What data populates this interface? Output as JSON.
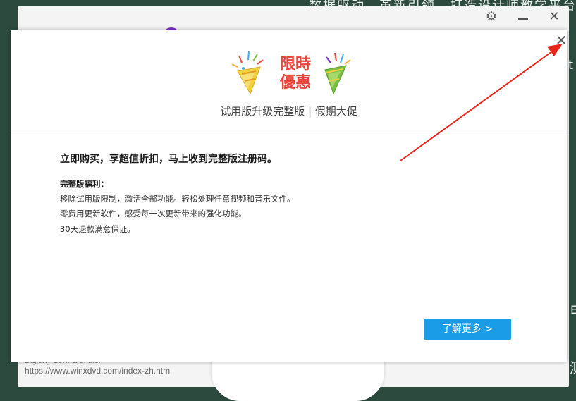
{
  "background": {
    "top_text": "数据驱动，革新引领，打造设计师教学平台",
    "side_char_1": "t",
    "side_char_2": "测",
    "side_char_3": "E"
  },
  "app_window": {
    "footer_company": "Digiarty Software, Inc.",
    "footer_url": "https://www.winxdvd.com/index-zh.htm"
  },
  "dialog": {
    "promo_title_line1": "限時",
    "promo_title_line2": "優惠",
    "subtitle": "试用版升级完整版 | 假期大促",
    "headline": "立即购买，享超值折扣，马上收到完整版注册码。",
    "benefits_title": "完整版福利：",
    "benefits": [
      "移除试用版限制，激活全部功能。轻松处理任意视频和音乐文件。",
      "零费用更新软件，感受每一次更新带来的强化功能。",
      "30天退款满意保证。"
    ],
    "learn_more_label": "了解更多 >"
  },
  "colors": {
    "accent_blue": "#1a9de6",
    "promo_red": "#e8443a",
    "arrow_red": "#e8261c",
    "desktop_green": "#2c4a3e"
  },
  "icons": {
    "gear": "gear-icon",
    "minimize": "minimize-icon",
    "close": "close-icon",
    "party_popper": "party-popper-icon"
  }
}
